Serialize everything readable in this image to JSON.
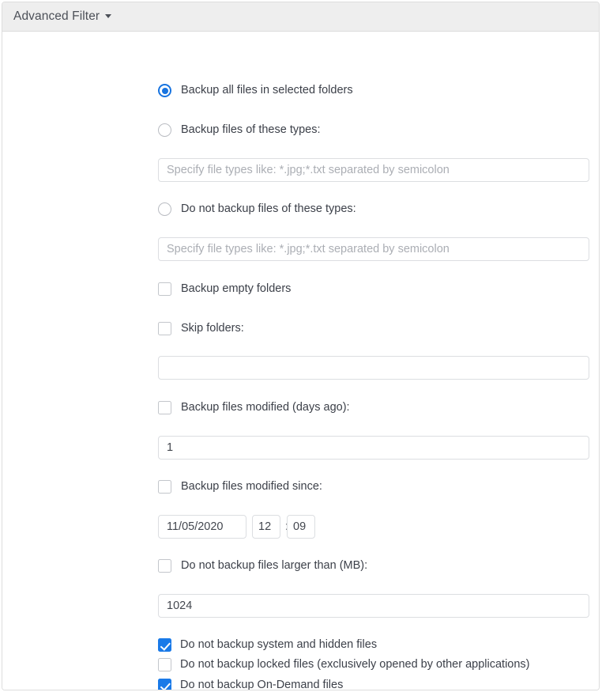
{
  "header": {
    "title": "Advanced Filter",
    "caret_icon": "chevron-down-icon"
  },
  "colors": {
    "accent": "#1a7ae8",
    "radio_accent": "#1874e0",
    "header_bg": "#eeeeee",
    "panel_border": "#dddddd",
    "text": "#3c4049",
    "placeholder": "#abaeb4",
    "input_border": "#dcdee1"
  },
  "filter": {
    "scope_radio_group": [
      {
        "label": "Backup all files in selected folders",
        "checked": true
      },
      {
        "label": "Backup files of these types:",
        "checked": false
      },
      {
        "label": "Do not backup files of these types:",
        "checked": false
      }
    ],
    "include_types_input": {
      "value": "",
      "placeholder": "Specify file types like: *.jpg;*.txt separated by semicolon"
    },
    "exclude_types_input": {
      "value": "",
      "placeholder": "Specify file types like: *.jpg;*.txt separated by semicolon"
    },
    "backup_empty_folders": {
      "label": "Backup empty folders",
      "checked": false
    },
    "skip_folders": {
      "label": "Skip folders:",
      "checked": false
    },
    "skip_folders_input": {
      "value": "",
      "placeholder": ""
    },
    "modified_days_ago": {
      "label": "Backup files modified (days ago):",
      "checked": false
    },
    "modified_days_ago_input": {
      "value": "1",
      "placeholder": ""
    },
    "modified_since": {
      "label": "Backup files modified since:",
      "checked": false
    },
    "modified_since_date": {
      "value": "11/05/2020",
      "placeholder": ""
    },
    "modified_since_hour": {
      "value": "12",
      "placeholder": ""
    },
    "modified_since_separator": ":",
    "modified_since_minute": {
      "value": "09",
      "placeholder": ""
    },
    "max_size": {
      "label": "Do not backup files larger than (MB):",
      "checked": false
    },
    "max_size_input": {
      "value": "1024",
      "placeholder": ""
    },
    "exclusions": [
      {
        "label": "Do not backup system and hidden files",
        "checked": true
      },
      {
        "label": "Do not backup locked files (exclusively opened by other applications)",
        "checked": false
      },
      {
        "label": "Do not backup On-Demand files",
        "checked": true
      }
    ]
  }
}
